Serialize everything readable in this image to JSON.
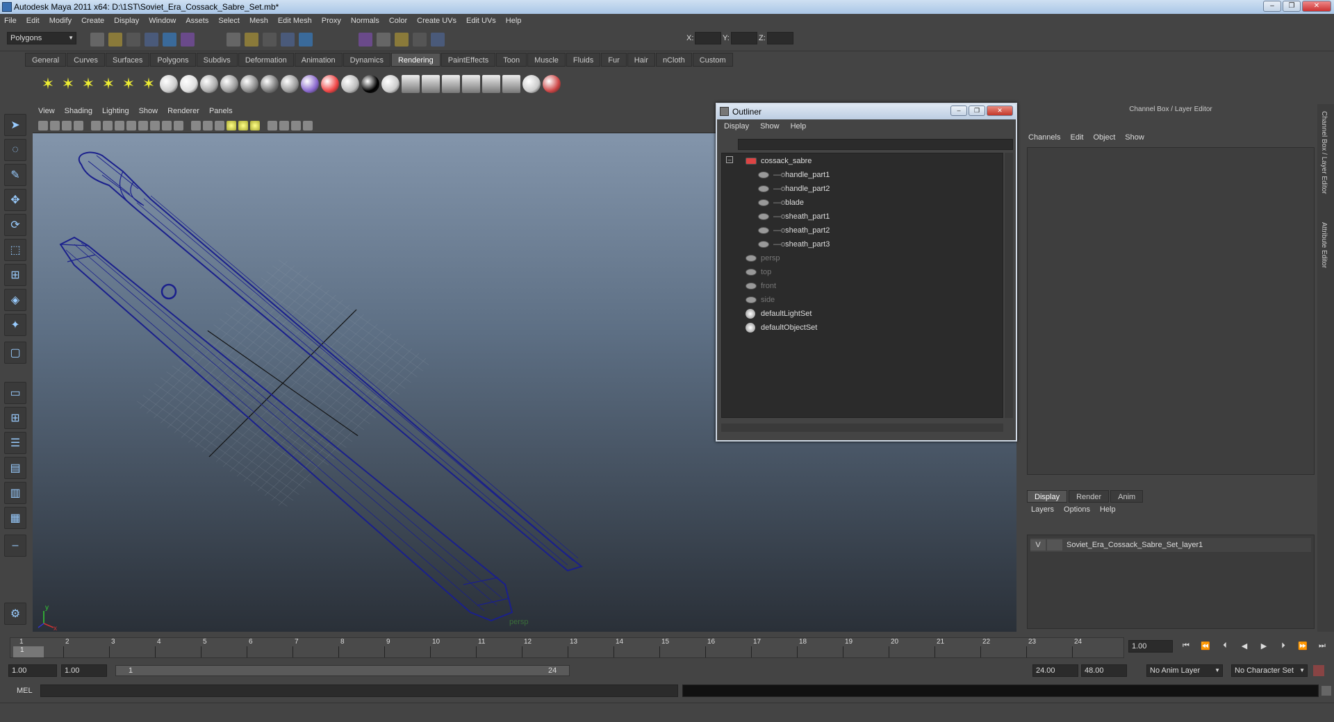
{
  "window": {
    "title": "Autodesk Maya 2011 x64: D:\\1ST\\Soviet_Era_Cossack_Sabre_Set.mb*",
    "buttons": [
      "–",
      "❐",
      "✕"
    ]
  },
  "menubar": [
    "File",
    "Edit",
    "Modify",
    "Create",
    "Display",
    "Window",
    "Assets",
    "Select",
    "Mesh",
    "Edit Mesh",
    "Proxy",
    "Normals",
    "Color",
    "Create UVs",
    "Edit UVs",
    "Help"
  ],
  "statusline": {
    "mode": "Polygons",
    "x_label": "X:",
    "y_label": "Y:",
    "z_label": "Z:"
  },
  "shelf_tabs": [
    "General",
    "Curves",
    "Surfaces",
    "Polygons",
    "Subdivs",
    "Deformation",
    "Animation",
    "Dynamics",
    "Rendering",
    "PaintEffects",
    "Toon",
    "Muscle",
    "Fluids",
    "Fur",
    "Hair",
    "nCloth",
    "Custom"
  ],
  "shelf_active": "Rendering",
  "viewport": {
    "menu": [
      "View",
      "Shading",
      "Lighting",
      "Show",
      "Renderer",
      "Panels"
    ],
    "camera_label": "persp"
  },
  "outliner": {
    "title": "Outliner",
    "menu": [
      "Display",
      "Show",
      "Help"
    ],
    "items": [
      {
        "label": "cossack_sabre",
        "level": 0,
        "kind": "transform"
      },
      {
        "label": "handle_part1",
        "level": 1,
        "kind": "mesh"
      },
      {
        "label": "handle_part2",
        "level": 1,
        "kind": "mesh"
      },
      {
        "label": "blade",
        "level": 1,
        "kind": "mesh"
      },
      {
        "label": "sheath_part1",
        "level": 1,
        "kind": "mesh"
      },
      {
        "label": "sheath_part2",
        "level": 1,
        "kind": "mesh"
      },
      {
        "label": "sheath_part3",
        "level": 1,
        "kind": "mesh"
      },
      {
        "label": "persp",
        "level": 0,
        "kind": "camera"
      },
      {
        "label": "top",
        "level": 0,
        "kind": "camera"
      },
      {
        "label": "front",
        "level": 0,
        "kind": "camera"
      },
      {
        "label": "side",
        "level": 0,
        "kind": "camera"
      },
      {
        "label": "defaultLightSet",
        "level": 0,
        "kind": "set"
      },
      {
        "label": "defaultObjectSet",
        "level": 0,
        "kind": "set"
      }
    ]
  },
  "channelbox": {
    "title": "Channel Box / Layer Editor",
    "menu": [
      "Channels",
      "Edit",
      "Object",
      "Show"
    ]
  },
  "layers": {
    "tabs": [
      "Display",
      "Render",
      "Anim"
    ],
    "menu": [
      "Layers",
      "Options",
      "Help"
    ],
    "layer_name": "Soviet_Era_Cossack_Sabre_Set_layer1",
    "layer_visible": "V"
  },
  "side_tabs": [
    "Channel Box / Layer Editor",
    "Attribute Editor"
  ],
  "timeline": {
    "ticks": [
      "1",
      "2",
      "3",
      "4",
      "5",
      "6",
      "7",
      "8",
      "9",
      "10",
      "11",
      "12",
      "13",
      "14",
      "15",
      "16",
      "17",
      "18",
      "19",
      "20",
      "21",
      "22",
      "23",
      "24"
    ],
    "current_frame": "1.00",
    "current_marker": "1"
  },
  "range": {
    "start": "1.00",
    "inner_start": "1.00",
    "slider_start": "1",
    "slider_end": "24",
    "end": "24.00",
    "outer_end": "48.00",
    "anim_layer": "No Anim Layer",
    "char_set": "No Character Set"
  },
  "cmdline": {
    "label": "MEL"
  },
  "colors": {
    "wire": "#1a1f8c",
    "grid": "#9aa4b0",
    "viewport_top": "#8395ab",
    "viewport_bottom": "#2a3038"
  }
}
